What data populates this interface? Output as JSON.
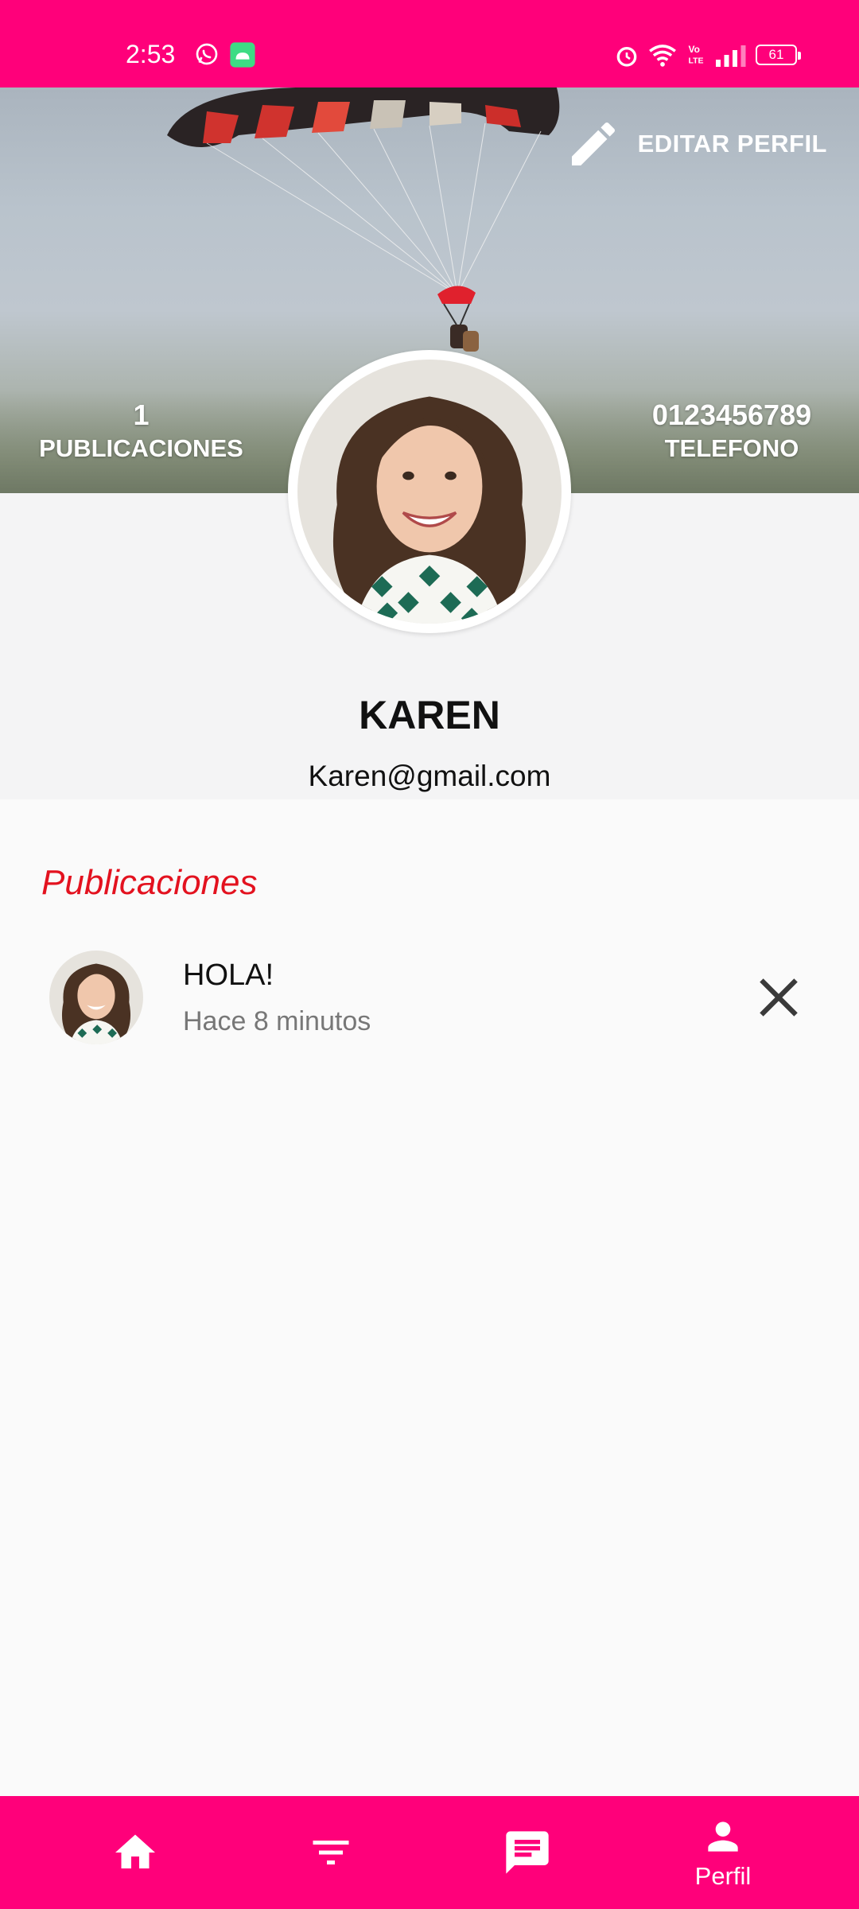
{
  "status_bar": {
    "time": "2:53",
    "battery": "61",
    "icons": [
      "whatsapp-icon",
      "android-icon",
      "alarm-icon",
      "wifi-icon",
      "volte-icon",
      "signal-icon",
      "battery-icon"
    ]
  },
  "header": {
    "edit_label": "EDITAR PERFIL",
    "posts_count": "1",
    "posts_label": "PUBLICACIONES",
    "phone": "0123456789",
    "phone_label": "TELEFONO"
  },
  "profile": {
    "name": "KAREN",
    "email": "Karen@gmail.com"
  },
  "posts_section": {
    "title": "Publicaciones",
    "items": [
      {
        "title": "HOLA!",
        "time": "Hace 8 minutos"
      }
    ]
  },
  "bottom_nav": {
    "items": [
      {
        "icon": "home-icon",
        "label": ""
      },
      {
        "icon": "filter-icon",
        "label": ""
      },
      {
        "icon": "chat-icon",
        "label": ""
      },
      {
        "icon": "person-icon",
        "label": "Perfil"
      }
    ]
  },
  "colors": {
    "accent": "#ff007a",
    "section_title": "#e3121f"
  }
}
